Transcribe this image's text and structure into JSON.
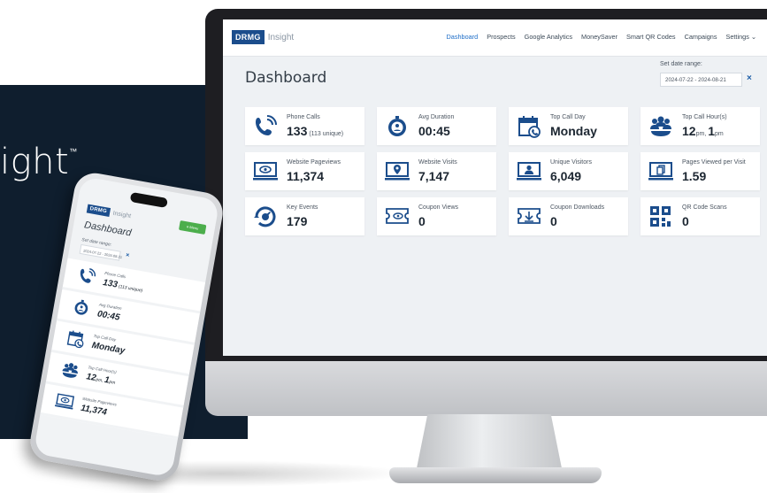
{
  "background": {
    "brand_word": "ight",
    "trademark": "™",
    "navy_color": "#0f1e2e"
  },
  "desktop": {
    "logo_box": "DRMG",
    "logo_text": "Insight",
    "nav": [
      {
        "label": "Dashboard",
        "active": true
      },
      {
        "label": "Prospects",
        "active": false
      },
      {
        "label": "Google Analytics",
        "active": false
      },
      {
        "label": "MoneySaver",
        "active": false
      },
      {
        "label": "Smart QR Codes",
        "active": false
      },
      {
        "label": "Campaigns",
        "active": false
      },
      {
        "label": "Settings ⌄",
        "active": false
      }
    ],
    "title": "Dashboard",
    "date_label": "Set date range:",
    "date_value": "2024-07-22 - 2024-08-21",
    "clear_icon": "×",
    "cards": [
      {
        "label": "Phone Calls",
        "value": "133",
        "suffix": "(113 unique)",
        "icon": "phone-icon"
      },
      {
        "label": "Avg Duration",
        "value": "00:45",
        "suffix": "",
        "icon": "stopwatch-icon"
      },
      {
        "label": "Top Call Day",
        "value": "Monday",
        "suffix": "",
        "icon": "calendar-phone-icon"
      },
      {
        "label": "Top Call Hour(s)",
        "value": "",
        "suffix": "",
        "icon": "users-phone-icon",
        "hours": [
          {
            "n": "12",
            "u": "pm"
          },
          {
            "n": "1",
            "u": "pm"
          }
        ]
      },
      {
        "label": "Website Pageviews",
        "value": "11,374",
        "suffix": "",
        "icon": "monitor-eye-icon"
      },
      {
        "label": "Website Visits",
        "value": "7,147",
        "suffix": "",
        "icon": "monitor-pin-icon"
      },
      {
        "label": "Unique Visitors",
        "value": "6,049",
        "suffix": "",
        "icon": "monitor-user-icon"
      },
      {
        "label": "Pages Viewed per Visit",
        "value": "1.59",
        "suffix": "",
        "icon": "monitor-pages-icon"
      },
      {
        "label": "Key Events",
        "value": "179",
        "suffix": "",
        "icon": "key-event-icon"
      },
      {
        "label": "Coupon Views",
        "value": "0",
        "suffix": "",
        "icon": "coupon-eye-icon"
      },
      {
        "label": "Coupon Downloads",
        "value": "0",
        "suffix": "",
        "icon": "coupon-download-icon"
      },
      {
        "label": "QR Code Scans",
        "value": "0",
        "suffix": "",
        "icon": "qr-code-icon"
      }
    ]
  },
  "mobile": {
    "logo_box": "DRMG",
    "logo_text": "Insight",
    "menu_button": "≡ Menu",
    "title": "Dashboard",
    "date_label": "Set date range:",
    "date_value": "2024-07-22 - 2024-08-21",
    "clear_icon": "×",
    "cards": [
      {
        "label": "Phone Calls",
        "value": "133",
        "suffix": "(113 unique)",
        "icon": "phone-icon"
      },
      {
        "label": "Avg Duration",
        "value": "00:45",
        "suffix": "",
        "icon": "stopwatch-icon"
      },
      {
        "label": "Top Call Day",
        "value": "Monday",
        "suffix": "",
        "icon": "calendar-phone-icon"
      },
      {
        "label": "Top Call Hour(s)",
        "value": "",
        "suffix": "",
        "icon": "users-phone-icon",
        "hours": [
          {
            "n": "12",
            "u": "pm"
          },
          {
            "n": "1",
            "u": "pm"
          }
        ]
      },
      {
        "label": "Website Pageviews",
        "value": "11,374",
        "suffix": "",
        "icon": "monitor-eye-icon"
      }
    ]
  },
  "colors": {
    "accent": "#1b4d8c",
    "nav_active": "#1e6ec8",
    "menu_green": "#4cae4c"
  }
}
